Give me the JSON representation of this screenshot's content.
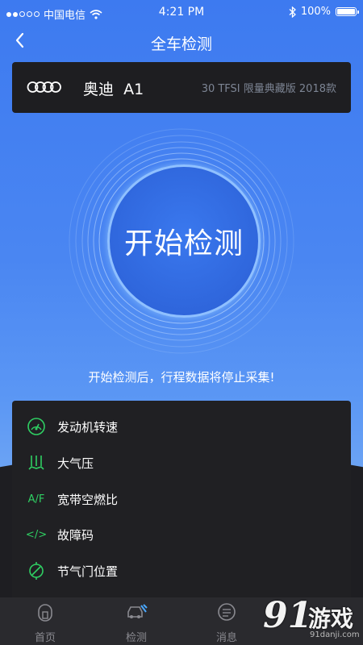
{
  "status_bar": {
    "carrier": "中国电信",
    "time": "4:21 PM",
    "battery_text": "100%"
  },
  "nav": {
    "title": "全车检测"
  },
  "car": {
    "brand": "奥迪",
    "series": "A1",
    "model": "30 TFSI 限量典藏版 2018款"
  },
  "start_button": {
    "label": "开始检测"
  },
  "notice": "开始检测后，行程数据将停止采集!",
  "features": [
    {
      "label": "发动机转速",
      "icon": "speedometer-icon"
    },
    {
      "label": "大气压",
      "icon": "pressure-icon"
    },
    {
      "label": "宽带空燃比",
      "icon_text": "A/F",
      "icon": "air-fuel-icon"
    },
    {
      "label": "故障码",
      "icon_text": "</>",
      "icon": "code-icon"
    },
    {
      "label": "节气门位置",
      "icon": "throttle-icon"
    }
  ],
  "tabs": [
    {
      "label": "首页",
      "icon": "home-icon"
    },
    {
      "label": "检测",
      "icon": "car-repair-icon"
    },
    {
      "label": "消息",
      "icon": "message-icon"
    }
  ],
  "watermark": {
    "number": "91",
    "text": "游戏",
    "url": "91danji.com"
  },
  "colors": {
    "accent_green": "#2fcf63",
    "primary_blue": "#3d7af0",
    "ring_light": "#8fc0ff"
  }
}
